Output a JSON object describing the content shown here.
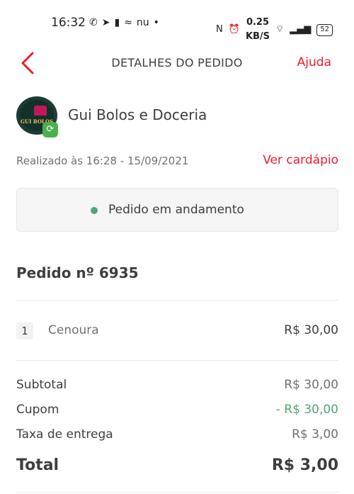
{
  "status_bar": {
    "time": "16:32",
    "left_icons": [
      "whatsapp-icon",
      "telegram-icon",
      "cup-icon",
      "ifood-icon",
      "nubank-icon",
      "dot-icon"
    ],
    "left_glyphs": [
      "✆",
      "➤",
      "▮",
      "≈",
      "nu",
      "•"
    ],
    "nfc": "N",
    "alarm": "⏰",
    "speed_value": "0.25",
    "speed_unit": "KB/S",
    "wifi": "⌔",
    "signal": "▂▄▆",
    "battery": "52"
  },
  "header": {
    "title": "DETALHES DO PEDIDO",
    "help_label": "Ajuda"
  },
  "store": {
    "name": "Gui Bolos e Doceria",
    "logo_text": "GUI BOLOS",
    "badge_glyph": "⟳"
  },
  "meta": {
    "placed_at": "Realizado às 16:28 - 15/09/2021",
    "menu_label": "Ver cardápio"
  },
  "order_status": {
    "text": "Pedido em andamento",
    "color": "#50a773"
  },
  "order": {
    "title": "Pedido nº 6935",
    "items": [
      {
        "qty": "1",
        "name": "Cenoura",
        "price": "R$ 30,00"
      }
    ]
  },
  "summary": {
    "subtotal_label": "Subtotal",
    "subtotal_value": "R$ 30,00",
    "coupon_label": "Cupom",
    "coupon_value": "- R$ 30,00",
    "delivery_label": "Taxa de entrega",
    "delivery_value": "R$ 3,00",
    "total_label": "Total",
    "total_value": "R$ 3,00"
  },
  "colors": {
    "accent": "#ea1d2c",
    "success": "#50a773",
    "text": "#3e3e3e",
    "muted": "#717171"
  }
}
